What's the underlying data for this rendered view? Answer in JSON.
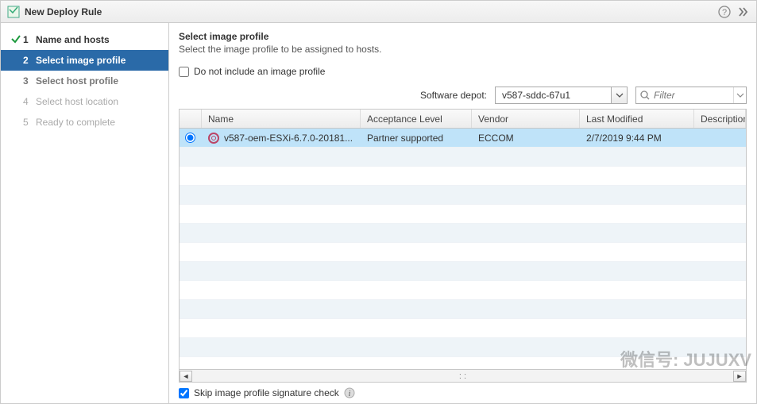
{
  "title": "New Deploy Rule",
  "steps": [
    {
      "num": "1",
      "label": "Name and hosts",
      "state": "done"
    },
    {
      "num": "2",
      "label": "Select image profile",
      "state": "active"
    },
    {
      "num": "3",
      "label": "Select host profile",
      "state": "future"
    },
    {
      "num": "4",
      "label": "Select host location",
      "state": "disabled"
    },
    {
      "num": "5",
      "label": "Ready to complete",
      "state": "disabled"
    }
  ],
  "page": {
    "heading": "Select image profile",
    "subheading": "Select the image profile to be assigned to hosts.",
    "no_include_label": "Do not include an image profile",
    "depot_label": "Software depot:",
    "depot_value": "v587-sddc-67u1",
    "filter_placeholder": "Filter",
    "skip_label": "Skip image profile signature check"
  },
  "columns": {
    "name": "Name",
    "acceptance": "Acceptance Level",
    "vendor": "Vendor",
    "modified": "Last Modified",
    "description": "Description"
  },
  "rows": [
    {
      "name": "v587-oem-ESXi-6.7.0-20181...",
      "acceptance": "Partner supported",
      "vendor": "ECCOM",
      "modified": "2/7/2019 9:44 PM",
      "description": "",
      "selected": true
    }
  ],
  "watermark": "微信号: JUJUXV"
}
